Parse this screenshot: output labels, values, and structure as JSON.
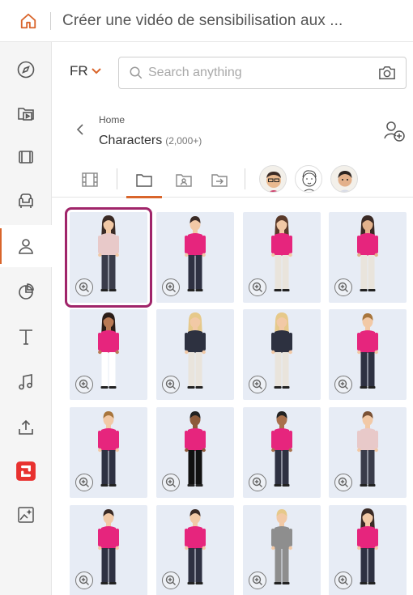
{
  "header": {
    "title": "Créer une vidéo de sensibilisation aux ..."
  },
  "sidebar": {
    "items": [
      {
        "name": "compass-icon"
      },
      {
        "name": "folder-video-icon"
      },
      {
        "name": "film-icon"
      },
      {
        "name": "armchair-icon"
      },
      {
        "name": "person-icon",
        "active": true
      },
      {
        "name": "pie-chart-icon"
      },
      {
        "name": "text-icon"
      },
      {
        "name": "music-icon"
      },
      {
        "name": "upload-icon"
      },
      {
        "name": "app-logo-icon"
      },
      {
        "name": "ai-image-icon"
      }
    ]
  },
  "toolbar": {
    "language": "FR"
  },
  "search": {
    "placeholder": "Search anything"
  },
  "breadcrumb": {
    "home": "Home",
    "title": "Characters",
    "count": "(2,000+)"
  },
  "colors": {
    "accent": "#d9652b",
    "selected_outline": "#a0256a",
    "card_bg": "#e7ecf5",
    "shirt_pink": "#e6257d"
  },
  "characters": [
    {
      "top": "#e8c9c9",
      "pants": "#3a3c4a",
      "hair": "#3a2a25",
      "skin": "#f2c9a6",
      "long": true,
      "selected": true
    },
    {
      "top": "#e6257d",
      "pants": "#2e3142",
      "hair": "#3a2a25",
      "skin": "#f2c9a6",
      "long": false
    },
    {
      "top": "#e6257d",
      "pants": "#e9e4dc",
      "hair": "#5a3a2a",
      "skin": "#f2c9a6",
      "long": true
    },
    {
      "top": "#e6257d",
      "pants": "#e9e4dc",
      "hair": "#3a2a25",
      "skin": "#e3b28c",
      "long": true
    },
    {
      "top": "#e6257d",
      "pants": "#ffffff",
      "hair": "#2b1d18",
      "skin": "#b97a55",
      "long": true
    },
    {
      "top": "#2d3140",
      "pants": "#e9e4dc",
      "hair": "#e6c98a",
      "skin": "#f2c9a6",
      "long": true
    },
    {
      "top": "#2d3140",
      "pants": "#e9e4dc",
      "hair": "#e6c98a",
      "skin": "#f2c9a6",
      "long": true
    },
    {
      "top": "#e6257d",
      "pants": "#2e3142",
      "hair": "#a8763d",
      "skin": "#f2c9a6",
      "long": false
    },
    {
      "top": "#e6257d",
      "pants": "#2e3142",
      "hair": "#a8763d",
      "skin": "#f2c9a6",
      "long": false
    },
    {
      "top": "#e6257d",
      "pants": "#111111",
      "hair": "#222222",
      "skin": "#8d5a3a",
      "long": false
    },
    {
      "top": "#e6257d",
      "pants": "#2e3142",
      "hair": "#222222",
      "skin": "#a8704c",
      "long": false
    },
    {
      "top": "#e8c9c9",
      "pants": "#3a3c4a",
      "hair": "#7a5236",
      "skin": "#f2c9a6",
      "long": false
    },
    {
      "top": "#e6257d",
      "pants": "#2e3142",
      "hair": "#3a2a25",
      "skin": "#f2c9a6",
      "long": false
    },
    {
      "top": "#e6257d",
      "pants": "#2e3142",
      "hair": "#3a2a25",
      "skin": "#f2c9a6",
      "long": false
    },
    {
      "top": "#8e8e8e",
      "pants": "#8e8e8e",
      "hair": "#e6c98a",
      "skin": "#f2c9a6",
      "long": false
    },
    {
      "top": "#e6257d",
      "pants": "#2e3142",
      "hair": "#3a2a25",
      "skin": "#f2c9a6",
      "long": true
    }
  ]
}
